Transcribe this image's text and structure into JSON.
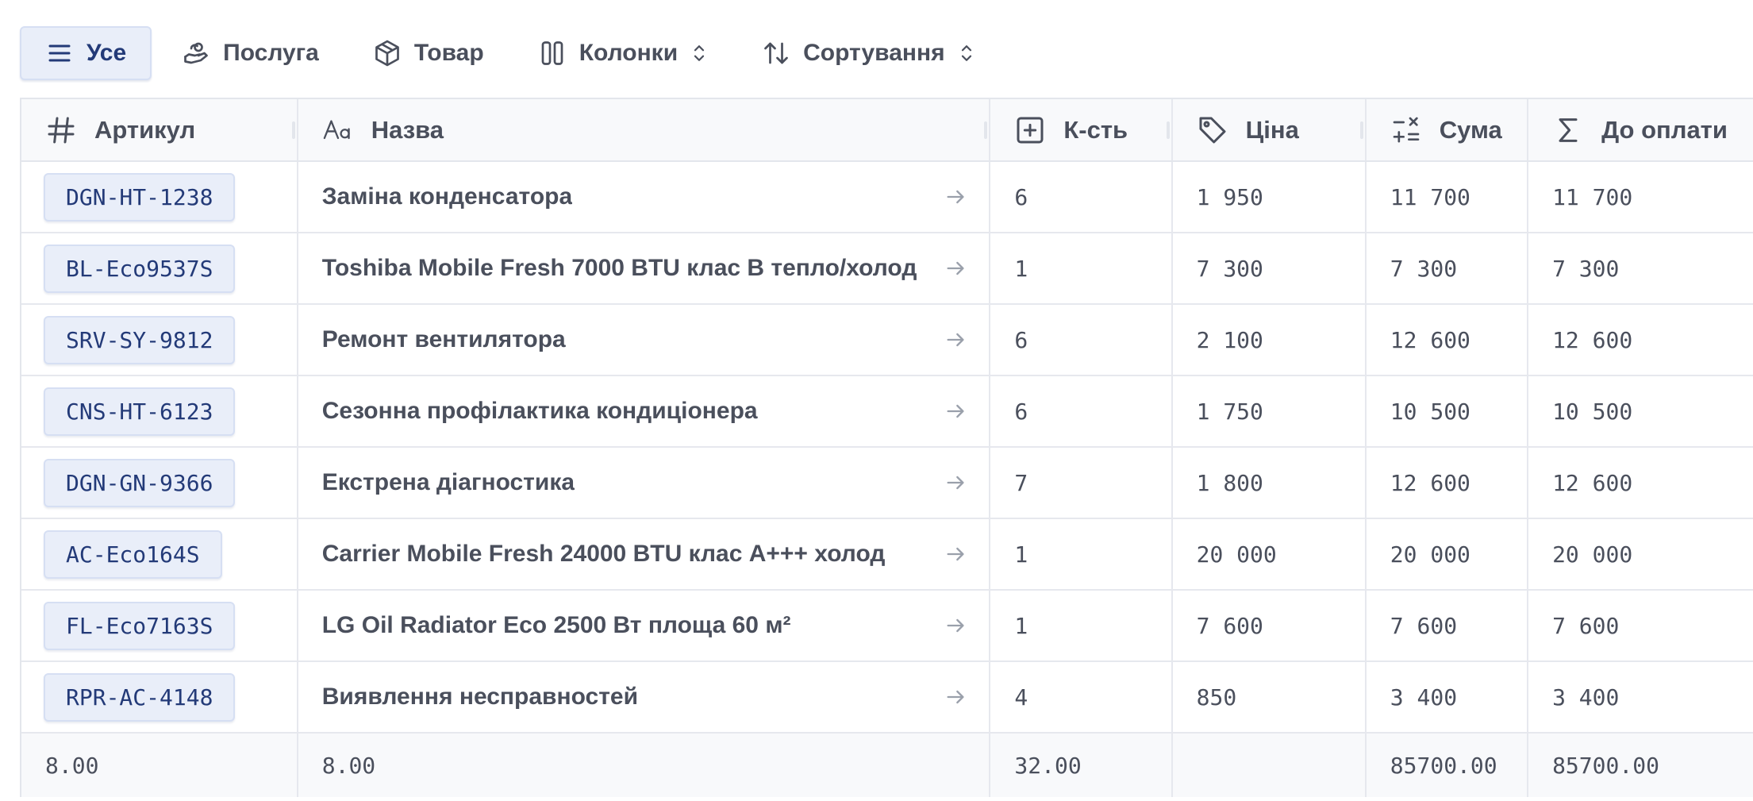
{
  "toolbar": {
    "all": "Усе",
    "service": "Послуга",
    "product": "Товар",
    "columns": "Колонки",
    "sort": "Сортування"
  },
  "columns": {
    "sku": "Артикул",
    "name": "Назва",
    "qty": "К-сть",
    "price": "Ціна",
    "sum": "Сума",
    "to_pay": "До оплати"
  },
  "rows": [
    {
      "sku": "DGN-HT-1238",
      "name": "Заміна конденсатора",
      "qty": "6",
      "price": "1 950",
      "sum": "11 700",
      "to_pay": "11 700"
    },
    {
      "sku": "BL-Eco9537S",
      "name": "Toshiba Mobile Fresh 7000 BTU клас B тепло/холод",
      "qty": "1",
      "price": "7 300",
      "sum": "7 300",
      "to_pay": "7 300"
    },
    {
      "sku": "SRV-SY-9812",
      "name": "Ремонт вентилятора",
      "qty": "6",
      "price": "2 100",
      "sum": "12 600",
      "to_pay": "12 600"
    },
    {
      "sku": "CNS-HT-6123",
      "name": "Сезонна профілактика кондиціонера",
      "qty": "6",
      "price": "1 750",
      "sum": "10 500",
      "to_pay": "10 500"
    },
    {
      "sku": "DGN-GN-9366",
      "name": "Екстрена діагностика",
      "qty": "7",
      "price": "1 800",
      "sum": "12 600",
      "to_pay": "12 600"
    },
    {
      "sku": "AC-Eco164S",
      "name": "Carrier Mobile Fresh 24000 BTU клас A+++ холод",
      "qty": "1",
      "price": "20 000",
      "sum": "20 000",
      "to_pay": "20 000"
    },
    {
      "sku": "FL-Eco7163S",
      "name": "LG Oil Radiator Eco 2500 Вт площа 60 м²",
      "qty": "1",
      "price": "7 600",
      "sum": "7 600",
      "to_pay": "7 600"
    },
    {
      "sku": "RPR-AC-4148",
      "name": "Виявлення несправностей",
      "qty": "4",
      "price": "850",
      "sum": "3 400",
      "to_pay": "3 400"
    }
  ],
  "footer": {
    "sku": "8.00",
    "name": "8.00",
    "qty": "32.00",
    "price": "",
    "sum": "85700.00",
    "to_pay": "85700.00"
  },
  "colors": {
    "accent": "#233a78",
    "chip_bg": "#e9eef9",
    "text": "#4a4f5c"
  }
}
